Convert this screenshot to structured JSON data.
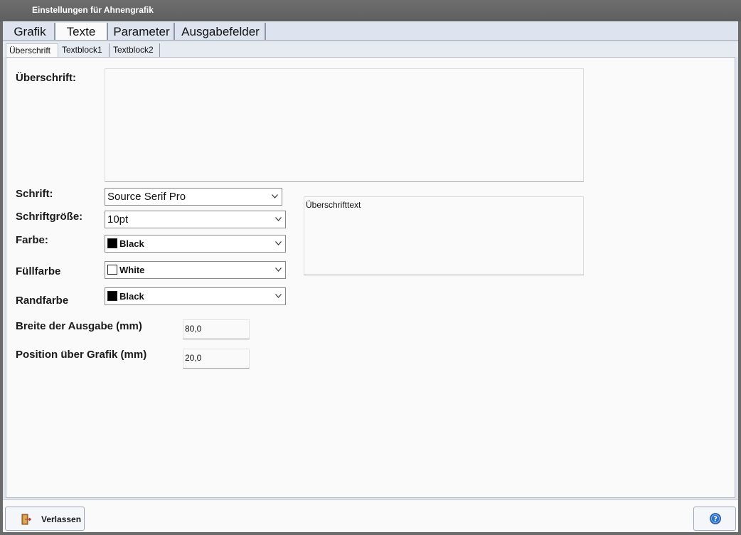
{
  "window": {
    "title": "Einstellungen für Ahnengrafik"
  },
  "main_tabs": [
    {
      "label": "Grafik"
    },
    {
      "label": "Texte"
    },
    {
      "label": "Parameter"
    },
    {
      "label": "Ausgabefelder"
    }
  ],
  "sub_tabs": [
    {
      "label": "Überschrift"
    },
    {
      "label": "Textblock1"
    },
    {
      "label": "Textblock2"
    }
  ],
  "form": {
    "heading_label": "Überschrift:",
    "heading_value": "",
    "font_label": "Schrift:",
    "font_value": "Source Serif Pro",
    "size_label": "Schriftgröße:",
    "size_value": "10pt",
    "color_label": "Farbe:",
    "color_value": "Black",
    "color_hex": "#000000",
    "fill_label": "Füllfarbe",
    "fill_value": "White",
    "fill_hex": "#ffffff",
    "border_label": "Randfarbe",
    "border_value": "Black",
    "border_hex": "#000000",
    "width_label": "Breite der Ausgabe (mm)",
    "width_value": "80,0",
    "position_label": "Position über Grafik (mm)",
    "position_value": "20,0",
    "preview_text": "Überschrifttext"
  },
  "footer": {
    "exit_label": "Verlassen",
    "exit_icon": "exit-door-icon",
    "help_icon": "help-icon",
    "help_color": "#2a6fc9"
  }
}
